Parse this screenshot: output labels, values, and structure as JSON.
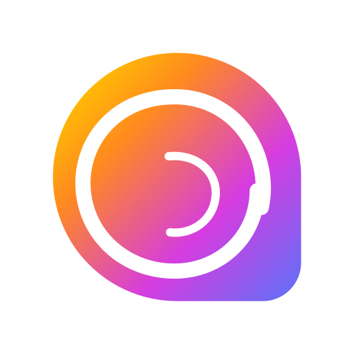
{
  "logo": {
    "icon": "spiral-shell-icon",
    "gradient_colors": [
      "#FFC400",
      "#FF8A1F",
      "#D63CE0",
      "#6A6CF5"
    ],
    "spiral_color": "#FFFFFF",
    "background_color": "#FFFFFF"
  }
}
